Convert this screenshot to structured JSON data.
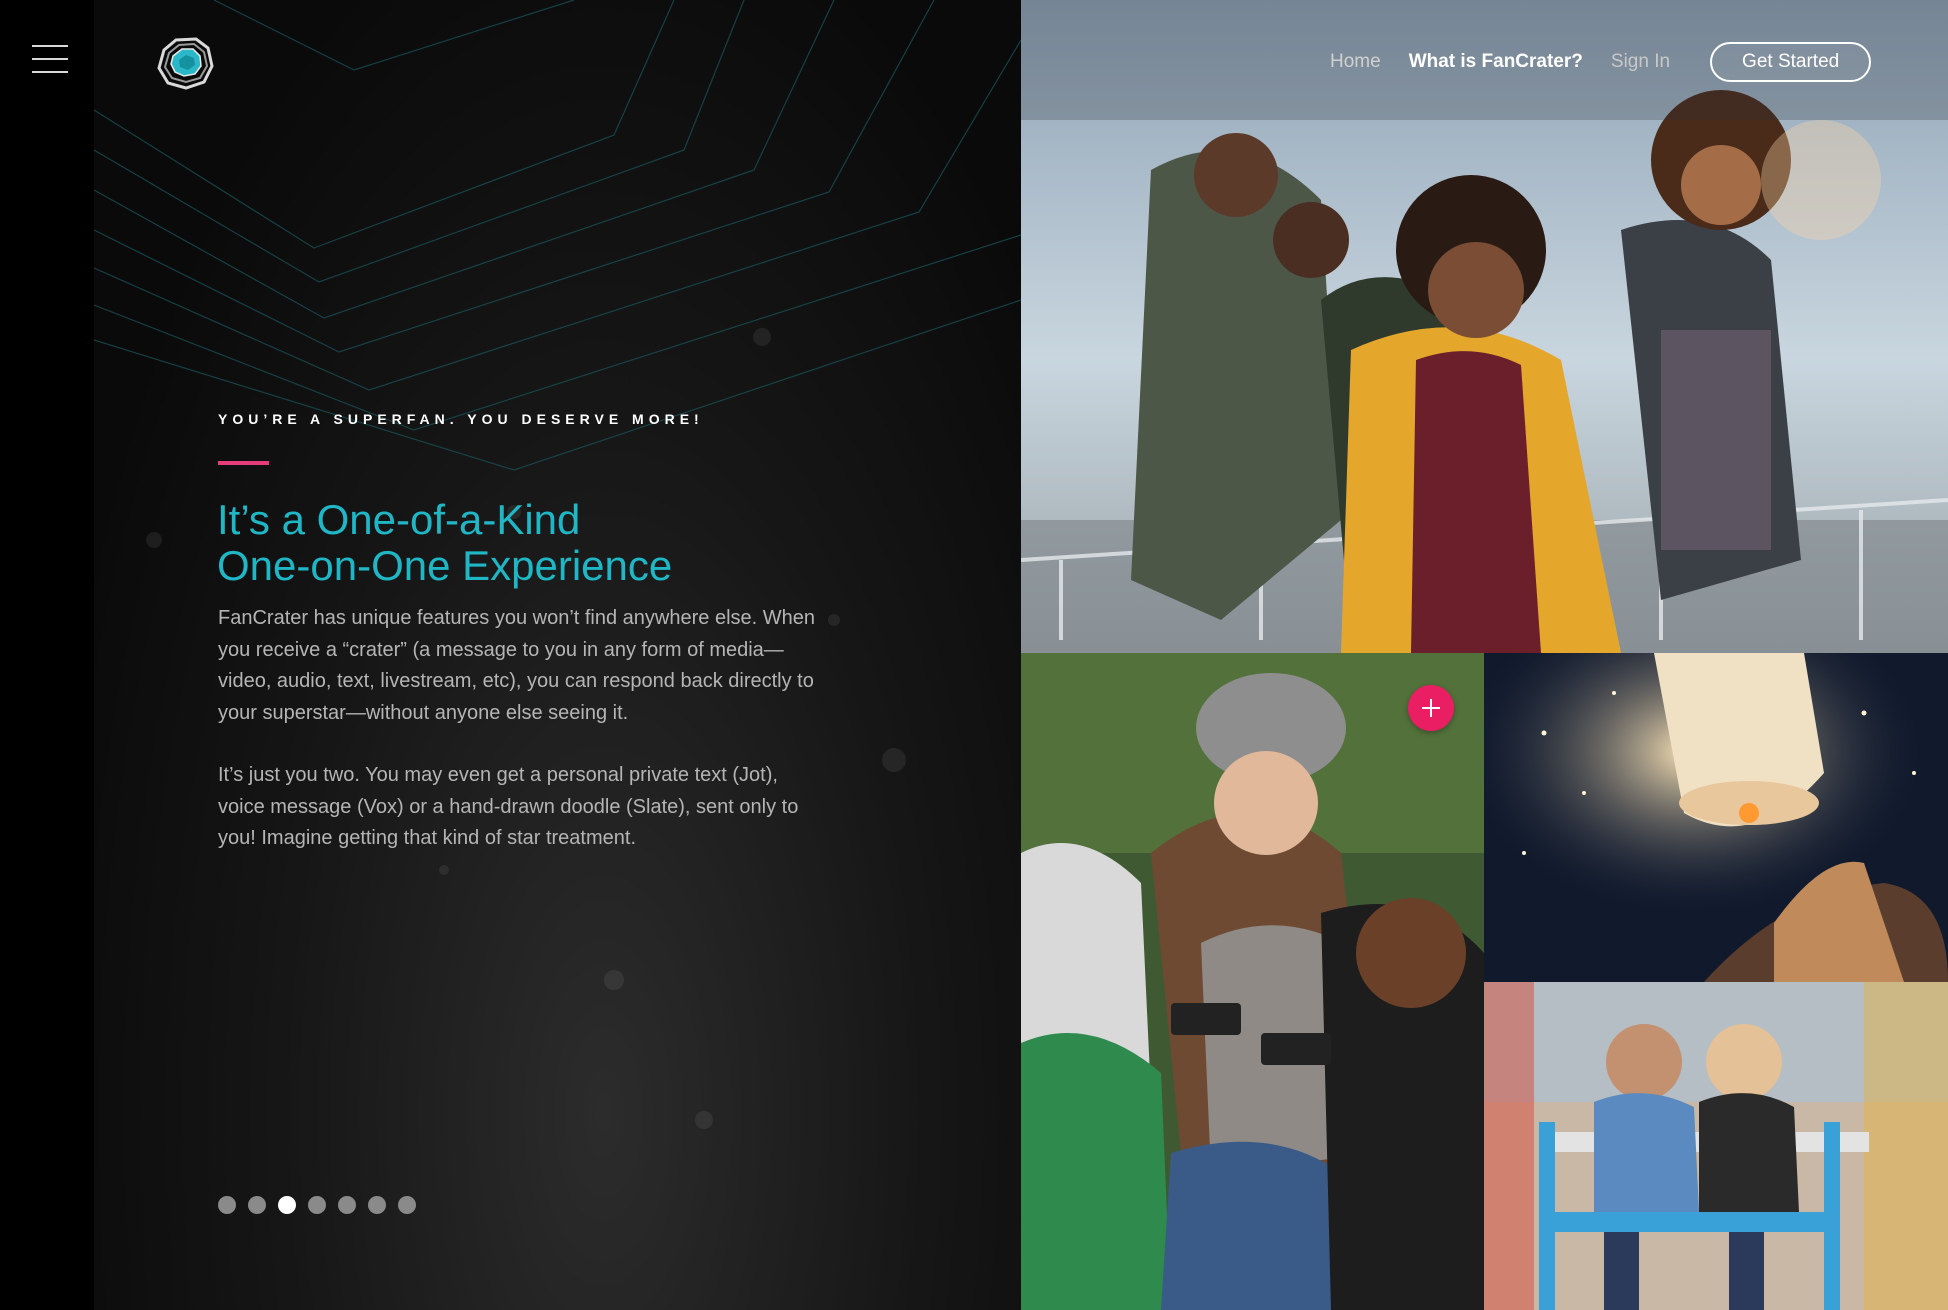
{
  "nav": {
    "items": [
      {
        "label": "Home"
      },
      {
        "label": "What is FanCrater?"
      },
      {
        "label": "Sign In"
      }
    ],
    "cta_label": "Get Started"
  },
  "hero": {
    "eyebrow": "YOU’RE A SUPERFAN. YOU DESERVE MORE!",
    "headline_line1": "It’s a One-of-a-Kind",
    "headline_line2": "One-on-One Experience",
    "paragraph1": "FanCrater has unique features you won’t find anywhere else. When you receive a “crater” (a message to you in any form of media—video, audio, text, livestream, etc), you can respond back directly to your superstar—without anyone else seeing it.",
    "paragraph2": "It’s just you two. You may even get a personal private text (Jot), voice message (Vox) or a hand-drawn doodle (Slate), sent only to you! Imagine getting that kind of star treatment."
  },
  "pager": {
    "total": 7,
    "active_index": 2
  },
  "icons": {
    "menu": "hamburger-icon",
    "logo": "fancrater-logo",
    "plus": "plus-icon"
  },
  "colors": {
    "accent_pink": "#e63c7a",
    "headline_teal": "#1fb7c6",
    "plus_button": "#e91e63"
  }
}
